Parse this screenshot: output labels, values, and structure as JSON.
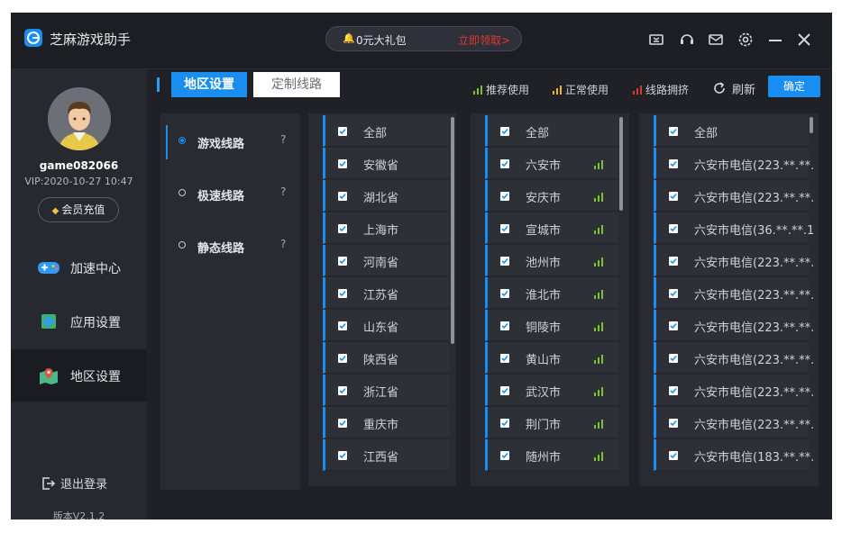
{
  "app": {
    "title": "芝麻游戏助手"
  },
  "promo": {
    "text": "0元大礼包",
    "link": "立即领取>"
  },
  "user": {
    "name": "game082066",
    "vip": "VIP:2020-10-27 10:47",
    "recharge_label": "会员充值"
  },
  "nav": [
    {
      "label": "加速中心",
      "icon": "gamepad-icon"
    },
    {
      "label": "应用设置",
      "icon": "puzzle-icon"
    },
    {
      "label": "地区设置",
      "icon": "map-pin-icon",
      "active": true
    }
  ],
  "sidebar_footer": {
    "logout_label": "退出登录",
    "version": "版本V2.1.2"
  },
  "tabs": [
    {
      "label": "地区设置",
      "active": true
    },
    {
      "label": "定制线路",
      "active": false
    }
  ],
  "legend": [
    {
      "label": "推荐使用",
      "color": "#7ec42f"
    },
    {
      "label": "正常使用",
      "color": "#f0b429"
    },
    {
      "label": "线路拥挤",
      "color": "#e0392f"
    }
  ],
  "refresh_label": "刷新",
  "confirm_label": "确定",
  "route_types": [
    {
      "label": "游戏线路",
      "help": "?",
      "selected": true
    },
    {
      "label": "极速线路",
      "help": "?",
      "selected": false
    },
    {
      "label": "静态线路",
      "help": "?",
      "selected": false
    }
  ],
  "provinces": [
    "全部",
    "安徽省",
    "湖北省",
    "上海市",
    "河南省",
    "江苏省",
    "山东省",
    "陕西省",
    "浙江省",
    "重庆市",
    "江西省"
  ],
  "cities": [
    "全部",
    "六安市",
    "安庆市",
    "宣城市",
    "池州市",
    "淮北市",
    "铜陵市",
    "黄山市",
    "武汉市",
    "荆门市",
    "随州市"
  ],
  "servers": [
    "全部",
    "六安市电信(223.**.**.",
    "六安市电信(223.**.**.",
    "六安市电信(36.**.**.1",
    "六安市电信(223.**.**.",
    "六安市电信(223.**.**.",
    "六安市电信(223.**.**.",
    "六安市电信(223.**.**.",
    "六安市电信(223.**.**.",
    "六安市电信(223.**.**.",
    "六安市电信(183.**.**."
  ],
  "colors": {
    "accent": "#1a8ef0",
    "signal_good": "#7ec42f",
    "bg": "#1f2127"
  }
}
